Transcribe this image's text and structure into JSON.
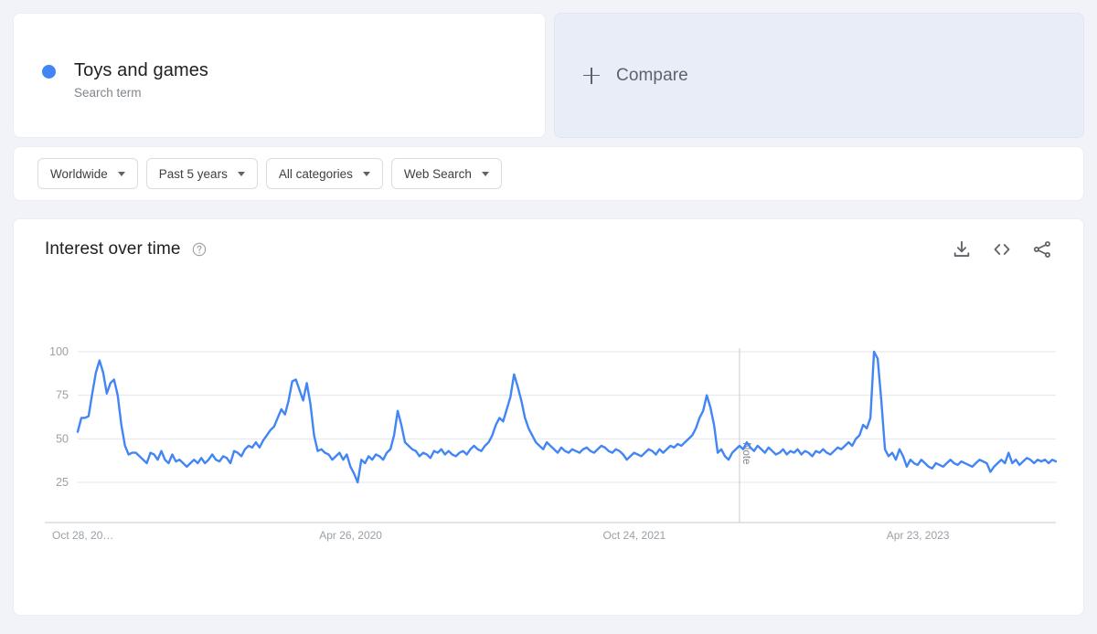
{
  "term_card": {
    "title": "Toys and games",
    "subtitle": "Search term",
    "dot_color": "#4285f4"
  },
  "compare_card": {
    "label": "Compare",
    "icon": "plus-icon"
  },
  "filters": [
    {
      "label": "Worldwide"
    },
    {
      "label": "Past 5 years"
    },
    {
      "label": "All categories"
    },
    {
      "label": "Web Search"
    }
  ],
  "chart_card": {
    "title": "Interest over time",
    "help_icon": "help-circle-icon",
    "tools": [
      {
        "name": "download-icon"
      },
      {
        "name": "embed-code-icon"
      },
      {
        "name": "share-icon"
      }
    ]
  },
  "chart_data": {
    "type": "line",
    "title": "Interest over time",
    "xlabel": "",
    "ylabel": "",
    "ylim": [
      0,
      100
    ],
    "grid": true,
    "legend_position": "none",
    "line_color": "#4285f4",
    "series_name": "Toys and games",
    "y_ticks": [
      100,
      75,
      50,
      25
    ],
    "x_tick_labels": [
      "Oct 28, 20…",
      "Apr 26, 2020",
      "Oct 24, 2021",
      "Apr 23, 2023"
    ],
    "x_tick_indices": [
      0,
      78,
      156,
      234
    ],
    "annotations": [
      {
        "label": "Note",
        "x_index": 182
      }
    ],
    "values": [
      54,
      62,
      62,
      63,
      76,
      88,
      95,
      88,
      76,
      82,
      84,
      75,
      58,
      46,
      41,
      42,
      42,
      40,
      38,
      36,
      42,
      41,
      38,
      43,
      38,
      36,
      41,
      37,
      38,
      36,
      34,
      36,
      38,
      36,
      39,
      36,
      38,
      41,
      38,
      37,
      40,
      39,
      36,
      43,
      42,
      40,
      44,
      46,
      45,
      48,
      45,
      49,
      52,
      55,
      57,
      62,
      67,
      64,
      72,
      83,
      84,
      78,
      72,
      82,
      70,
      52,
      43,
      44,
      42,
      41,
      38,
      40,
      42,
      38,
      41,
      34,
      30,
      25,
      38,
      36,
      40,
      38,
      41,
      40,
      38,
      42,
      44,
      52,
      66,
      58,
      48,
      46,
      44,
      43,
      40,
      42,
      41,
      39,
      43,
      42,
      44,
      41,
      43,
      41,
      40,
      42,
      43,
      41,
      44,
      46,
      44,
      43,
      46,
      48,
      52,
      58,
      62,
      60,
      67,
      74,
      87,
      80,
      72,
      62,
      56,
      52,
      48,
      46,
      44,
      48,
      46,
      44,
      42,
      45,
      43,
      42,
      44,
      43,
      42,
      44,
      45,
      43,
      42,
      44,
      46,
      45,
      43,
      42,
      44,
      43,
      41,
      38,
      40,
      42,
      41,
      40,
      42,
      44,
      43,
      41,
      44,
      42,
      44,
      46,
      45,
      47,
      46,
      48,
      50,
      52,
      56,
      62,
      66,
      75,
      68,
      58,
      42,
      44,
      40,
      38,
      42,
      44,
      46,
      44,
      48,
      45,
      43,
      46,
      44,
      42,
      45,
      43,
      41,
      42,
      44,
      41,
      43,
      42,
      44,
      41,
      43,
      42,
      40,
      43,
      42,
      44,
      42,
      41,
      43,
      45,
      44,
      46,
      48,
      46,
      50,
      52,
      58,
      56,
      62,
      100,
      96,
      72,
      44,
      40,
      42,
      38,
      44,
      40,
      34,
      38,
      36,
      35,
      38,
      36,
      34,
      33,
      36,
      35,
      34,
      36,
      38,
      36,
      35,
      37,
      36,
      35,
      34,
      36,
      38,
      37,
      36,
      31,
      34,
      36,
      38,
      36,
      42,
      36,
      38,
      35,
      37,
      39,
      38,
      36,
      38,
      37,
      38,
      36,
      38,
      37
    ]
  }
}
